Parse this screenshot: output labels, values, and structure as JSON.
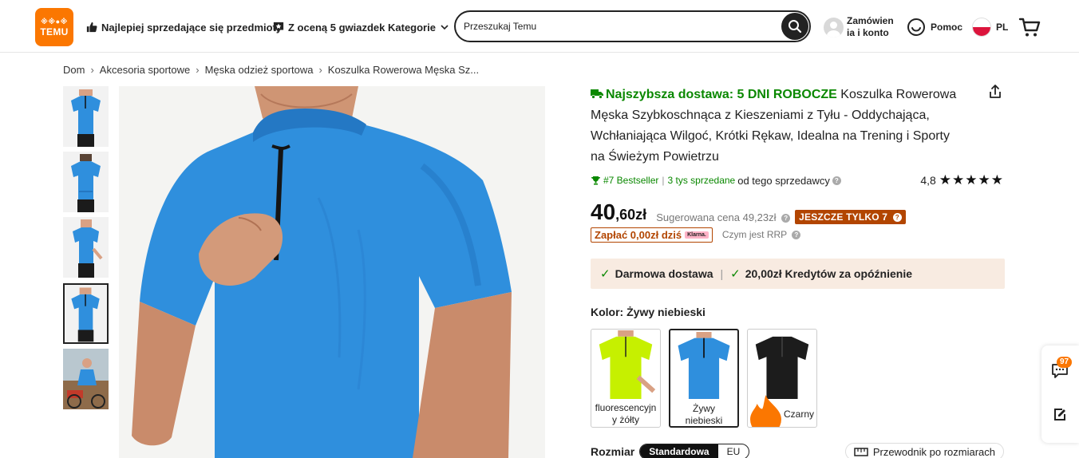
{
  "header": {
    "logo": {
      "top": "※※●※",
      "main": "TEMU"
    },
    "nav": {
      "bestsellers": "Najlepiej sprzedające się przedmioty",
      "five_stars": "Z oceną 5 gwiazdek",
      "categories": "Kategorie"
    },
    "search": {
      "placeholder": "Przeszukaj Temu"
    },
    "account": "Zamówien ia i konto",
    "help": "Pomoc",
    "language": "PL"
  },
  "breadcrumb": [
    "Dom",
    "Akcesoria sportowe",
    "Męska odzież sportowa",
    "Koszulka Rowerowa Męska Sz..."
  ],
  "breadcrumb_sep": "›",
  "product": {
    "delivery_prefix": "Najszybsza dostawa: 5 DNI ROBOCZE",
    "title": "Koszulka Rowerowa Męska Szybkoschnąca z Kieszeniami z Tyłu - Oddychająca, Wchłaniająca Wilgoć, Krótki Rękaw, Idealna na Trening i Sporty na Świeżym Powietrzu",
    "bestseller": "#7 Bestseller",
    "sold": "3 tys sprzedane",
    "seller": "od tego sprzedawcy",
    "rating": "4,8",
    "stars": "★★★★★",
    "price_main": "40",
    "price_decimal": ",60zł",
    "rrp": "Sugerowana cena 49,23zł",
    "last_badge": "JESZCZE TYLKO 7",
    "pay_today": "Zapłać 0,00zł dziś",
    "klarna": "Klarna.",
    "rrp_question": "Czym jest RRP",
    "benefit_free_shipping": "Darmowa dostawa",
    "benefit_credit": "20,00zł Kredytów za opóźnienie",
    "color_label": "Kolor: Żywy niebieski",
    "colors": [
      {
        "label": "fluorescencyjn y żółty",
        "hex": "#c6f000"
      },
      {
        "label": "Żywy niebieski",
        "hex": "#2f8fdd"
      },
      {
        "label": "Czarny",
        "hex": "#1c1c1c"
      }
    ],
    "size_label": "Rozmiar",
    "size_options": [
      "Standardowa",
      "EU"
    ],
    "size_guide": "Przewodnik po rozmiarach"
  },
  "float_widget": {
    "badge": "97"
  },
  "colors": {
    "accent": "#fb7701",
    "green": "#0a8800",
    "badge_red": "#b24500",
    "shirt_blue": "#2f8fdd"
  }
}
